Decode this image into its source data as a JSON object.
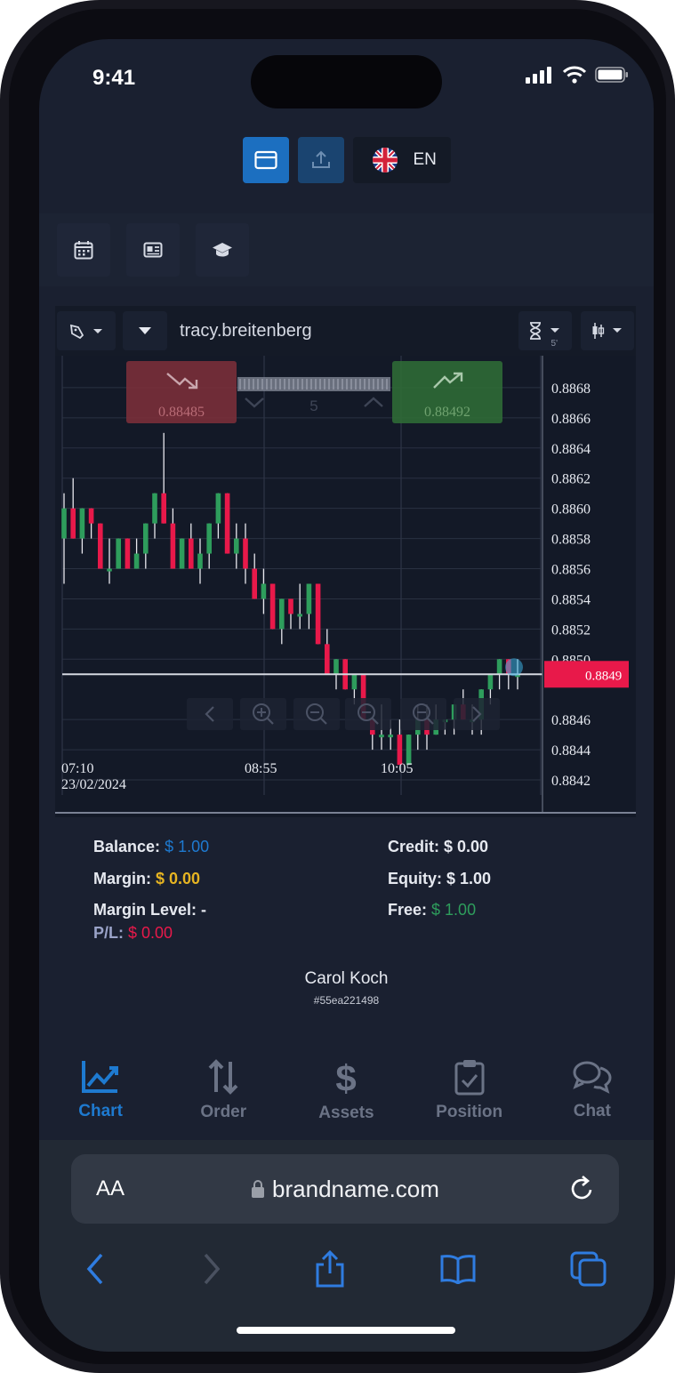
{
  "status_bar": {
    "time": "9:41"
  },
  "topbar": {
    "language": "EN"
  },
  "chart_header": {
    "symbol": "tracy.breitenberg",
    "timeframe": "5'"
  },
  "trade_panel": {
    "sell_price": "0.88485",
    "buy_price": "0.88492",
    "amount": "5"
  },
  "chart_data": {
    "type": "candlestick",
    "y_ticks": [
      "0.8868",
      "0.8866",
      "0.8864",
      "0.8862",
      "0.8860",
      "0.8858",
      "0.8856",
      "0.8854",
      "0.8852",
      "0.8850",
      "0.8846",
      "0.8844",
      "0.8842"
    ],
    "ylim": [
      0.8841,
      0.887
    ],
    "current_price": "0.8849",
    "x_ticks": [
      {
        "time": "07:10",
        "date": "23/02/2024"
      },
      {
        "time": "08:55",
        "date": ""
      },
      {
        "time": "10:05",
        "date": ""
      }
    ],
    "candles": [
      [
        0.8858,
        0.8861,
        0.8855,
        0.886
      ],
      [
        0.886,
        0.8862,
        0.8858,
        0.8858
      ],
      [
        0.8858,
        0.886,
        0.8857,
        0.886
      ],
      [
        0.886,
        0.886,
        0.8858,
        0.8859
      ],
      [
        0.8859,
        0.8859,
        0.8856,
        0.8856
      ],
      [
        0.8856,
        0.8858,
        0.8855,
        0.8856
      ],
      [
        0.8856,
        0.8858,
        0.8856,
        0.8858
      ],
      [
        0.8858,
        0.8858,
        0.8856,
        0.8856
      ],
      [
        0.8856,
        0.8858,
        0.8856,
        0.8857
      ],
      [
        0.8857,
        0.8859,
        0.8856,
        0.8859
      ],
      [
        0.8859,
        0.8861,
        0.8858,
        0.8861
      ],
      [
        0.8861,
        0.8865,
        0.8859,
        0.8859
      ],
      [
        0.8859,
        0.886,
        0.8856,
        0.8856
      ],
      [
        0.8856,
        0.8858,
        0.8856,
        0.8858
      ],
      [
        0.8858,
        0.8859,
        0.8856,
        0.8856
      ],
      [
        0.8856,
        0.8858,
        0.8855,
        0.8857
      ],
      [
        0.8857,
        0.8859,
        0.8856,
        0.8859
      ],
      [
        0.8859,
        0.8861,
        0.8858,
        0.8861
      ],
      [
        0.8861,
        0.8861,
        0.8857,
        0.8857
      ],
      [
        0.8857,
        0.8859,
        0.8856,
        0.8858
      ],
      [
        0.8858,
        0.8859,
        0.8855,
        0.8856
      ],
      [
        0.8856,
        0.8857,
        0.8854,
        0.8854
      ],
      [
        0.8854,
        0.8856,
        0.8853,
        0.8855
      ],
      [
        0.8855,
        0.8855,
        0.8852,
        0.8852
      ],
      [
        0.8852,
        0.8854,
        0.8851,
        0.8854
      ],
      [
        0.8854,
        0.8854,
        0.8852,
        0.8853
      ],
      [
        0.8853,
        0.8855,
        0.8852,
        0.8853
      ],
      [
        0.8853,
        0.8855,
        0.8852,
        0.8855
      ],
      [
        0.8855,
        0.8855,
        0.8851,
        0.8851
      ],
      [
        0.8851,
        0.8852,
        0.8849,
        0.8849
      ],
      [
        0.8849,
        0.885,
        0.8848,
        0.885
      ],
      [
        0.885,
        0.885,
        0.8848,
        0.8848
      ],
      [
        0.8848,
        0.8849,
        0.8847,
        0.8849
      ],
      [
        0.8849,
        0.8849,
        0.8846,
        0.8846
      ],
      [
        0.8846,
        0.8846,
        0.8844,
        0.8845
      ],
      [
        0.8845,
        0.8847,
        0.8844,
        0.8845
      ],
      [
        0.8845,
        0.8846,
        0.8844,
        0.8845
      ],
      [
        0.8845,
        0.8846,
        0.8843,
        0.8843
      ],
      [
        0.8843,
        0.8845,
        0.8843,
        0.8845
      ],
      [
        0.8845,
        0.8847,
        0.8844,
        0.8846
      ],
      [
        0.8846,
        0.8847,
        0.8844,
        0.8845
      ],
      [
        0.8845,
        0.8847,
        0.8845,
        0.8846
      ],
      [
        0.8846,
        0.8846,
        0.8845,
        0.8846
      ],
      [
        0.8846,
        0.8847,
        0.8845,
        0.8847
      ],
      [
        0.8847,
        0.8848,
        0.8846,
        0.8846
      ],
      [
        0.8846,
        0.8847,
        0.8845,
        0.8846
      ],
      [
        0.8846,
        0.8848,
        0.8845,
        0.8848
      ],
      [
        0.8848,
        0.8849,
        0.8847,
        0.8849
      ],
      [
        0.8849,
        0.885,
        0.8848,
        0.885
      ],
      [
        0.885,
        0.885,
        0.8848,
        0.8849
      ],
      [
        0.8849,
        0.885,
        0.8848,
        0.8849
      ]
    ],
    "colors": {
      "up": "#2e9d5c",
      "down": "#e8194a"
    }
  },
  "account": {
    "balance_label": "Balance:",
    "balance_value": "$ 1.00",
    "credit_label": "Credit:",
    "credit_value": "$ 0.00",
    "margin_label": "Margin:",
    "margin_value": "$ 0.00",
    "equity_label": "Equity:",
    "equity_value": "$ 1.00",
    "margin_level_label": "Margin Level:",
    "margin_level_value": "-",
    "free_label": "Free:",
    "free_value": "$ 1.00",
    "pl_label": "P/L:",
    "pl_value": "$ 0.00"
  },
  "user": {
    "name": "Carol Koch",
    "id": "#55ea221498"
  },
  "bottom_nav": [
    {
      "label": "Chart",
      "icon": "chart-icon",
      "active": true
    },
    {
      "label": "Order",
      "icon": "order-arrows-icon",
      "active": false
    },
    {
      "label": "Assets",
      "icon": "dollar-icon",
      "active": false
    },
    {
      "label": "Position",
      "icon": "clipboard-icon",
      "active": false
    },
    {
      "label": "Chat",
      "icon": "chat-icon",
      "active": false
    }
  ],
  "browser": {
    "text_size": "AA",
    "url": "brandname.com"
  },
  "colors": {
    "accent": "#1e7ad0",
    "balance": "#1e7ad0",
    "margin": "#e6b422",
    "free": "#2e9d5c",
    "pl": "#e8194a",
    "price_tag": "#e8194a"
  }
}
